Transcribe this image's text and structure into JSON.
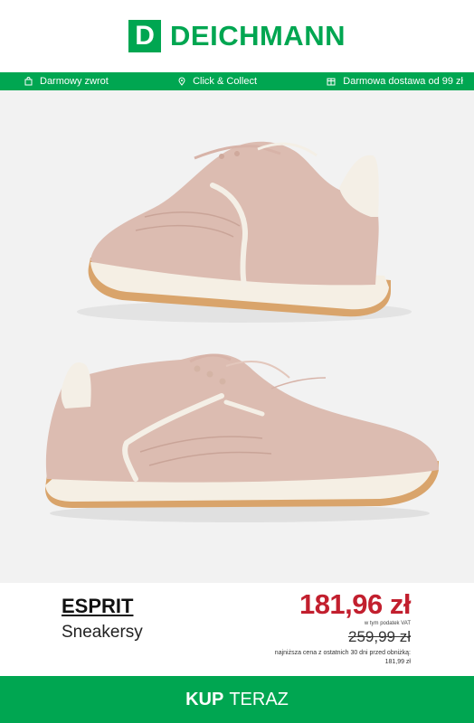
{
  "header": {
    "logo_letter": "D",
    "logo_text": "DEICHMANN",
    "brand_color": "#00a651"
  },
  "benefits": [
    {
      "icon": "return-bag-icon",
      "label": "Darmowy zwrot"
    },
    {
      "icon": "location-pin-icon",
      "label": "Click & Collect"
    },
    {
      "icon": "delivery-box-icon",
      "label": "Darmowa dostawa od 99 zł"
    }
  ],
  "product": {
    "image": "pink-suede-sneakers",
    "brand": "ESPRIT",
    "category": "Sneakersy",
    "price": "181,96 zł",
    "price_color": "#c21f2e",
    "vat_note": "w tym podatek VAT",
    "old_price": "259,99 zł",
    "lowest_price_note": "najniższa cena z ostatnich 30 dni przed obniżką:",
    "lowest_price_value": "181,99 zł"
  },
  "cta": {
    "bold": "KUP",
    "normal": "TERAZ"
  }
}
